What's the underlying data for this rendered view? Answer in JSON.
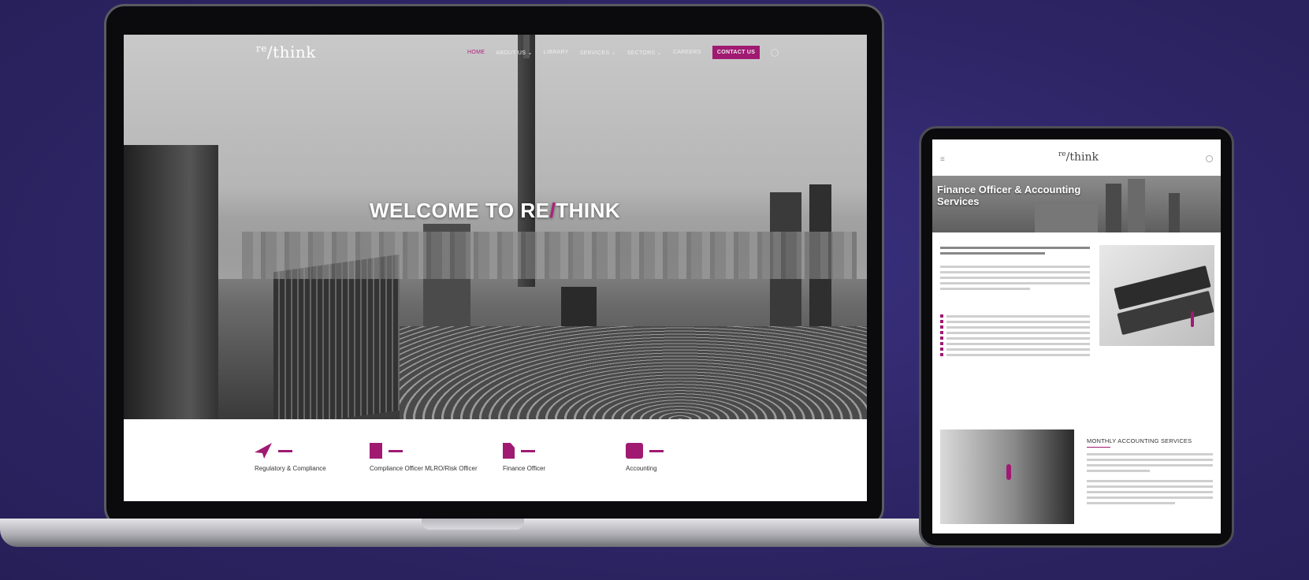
{
  "laptop": {
    "logo_main": "re",
    "logo_rest": "/think",
    "nav": {
      "home": "HOME",
      "about": "ABOUT US ⌄",
      "library": "LIBRARY",
      "services": "SERVICES ⌄",
      "sectors": "SECTORS ⌄",
      "careers": "CAREERS",
      "contact": "CONTACT US"
    },
    "hero": {
      "welcome_prefix": "WELCOME TO RE",
      "welcome_slash": "/",
      "welcome_suffix": "THINK"
    },
    "services": [
      {
        "title": "Regulatory & Compliance",
        "icon": "paper-plane-icon"
      },
      {
        "title": "Compliance Officer MLRO/Risk Officer",
        "icon": "building-icon"
      },
      {
        "title": "Finance Officer",
        "icon": "document-icon"
      },
      {
        "title": "Accounting",
        "icon": "list-icon"
      }
    ]
  },
  "tablet": {
    "logo_main": "re",
    "logo_rest": "/think",
    "banner_title": "Finance Officer & Accounting Services",
    "section_title": "MONTHLY ACCOUNTING SERVICES"
  },
  "colors": {
    "accent": "#a01a72",
    "background": "#2e2566"
  }
}
